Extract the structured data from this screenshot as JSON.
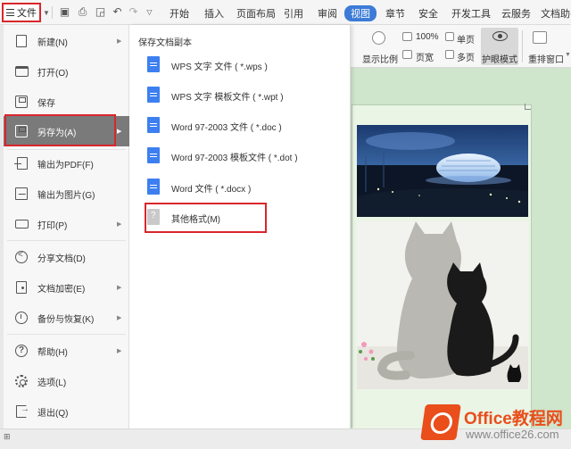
{
  "menubar": {
    "file_label": "文件",
    "tabs": [
      "开始",
      "插入",
      "页面布局",
      "引用",
      "审阅",
      "视图",
      "章节",
      "安全",
      "开发工具",
      "云服务",
      "文档助手"
    ],
    "active_tab": "视图",
    "accent_color": "#3c7bd6"
  },
  "ribbon": {
    "zoom_value": "100%",
    "display_ratio": "显示比例",
    "page_width": "页宽",
    "single_page": "单页",
    "multi_page": "多页",
    "eye_mode": "护眼模式",
    "rearrange": "重排窗口"
  },
  "file_menu": {
    "items": [
      {
        "label": "新建(N)",
        "icon": "new-doc-icon",
        "arrow": true
      },
      {
        "label": "打开(O)",
        "icon": "folder-icon",
        "arrow": false
      },
      {
        "label": "保存",
        "icon": "save-icon",
        "arrow": false
      },
      {
        "label": "另存为(A)",
        "icon": "save-as-icon",
        "arrow": true
      },
      {
        "label": "输出为PDF(F)",
        "icon": "pdf-icon",
        "arrow": false
      },
      {
        "label": "输出为图片(G)",
        "icon": "image-icon",
        "arrow": false
      },
      {
        "label": "打印(P)",
        "icon": "print-icon",
        "arrow": true
      },
      {
        "label": "分享文档(D)",
        "icon": "share-icon",
        "arrow": false
      },
      {
        "label": "文档加密(E)",
        "icon": "lock-icon",
        "arrow": true
      },
      {
        "label": "备份与恢复(K)",
        "icon": "backup-icon",
        "arrow": true
      },
      {
        "label": "帮助(H)",
        "icon": "help-icon",
        "arrow": true
      },
      {
        "label": "选项(L)",
        "icon": "gear-icon",
        "arrow": false
      },
      {
        "label": "退出(Q)",
        "icon": "exit-icon",
        "arrow": false
      }
    ],
    "active_item": "另存为(A)",
    "highlight_color": "#d9262c"
  },
  "save_as_panel": {
    "title": "保存文档副本",
    "items": [
      {
        "label": "WPS 文字 文件 ( *.wps )",
        "icon": "wps-file-icon"
      },
      {
        "label": "WPS 文字 模板文件 ( *.wpt )",
        "icon": "wps-template-icon"
      },
      {
        "label": "Word 97-2003 文件 ( *.doc )",
        "icon": "word-doc-icon"
      },
      {
        "label": "Word 97-2003 模板文件 ( *.dot )",
        "icon": "word-template-icon"
      },
      {
        "label": "Word 文件 ( *.docx )",
        "icon": "word-docx-icon"
      },
      {
        "label": "其他格式(M)",
        "icon": "other-format-icon"
      }
    ]
  },
  "watermark": {
    "brand": "Office教程网",
    "url": "www.office26.com",
    "color": "#e94e1b"
  }
}
